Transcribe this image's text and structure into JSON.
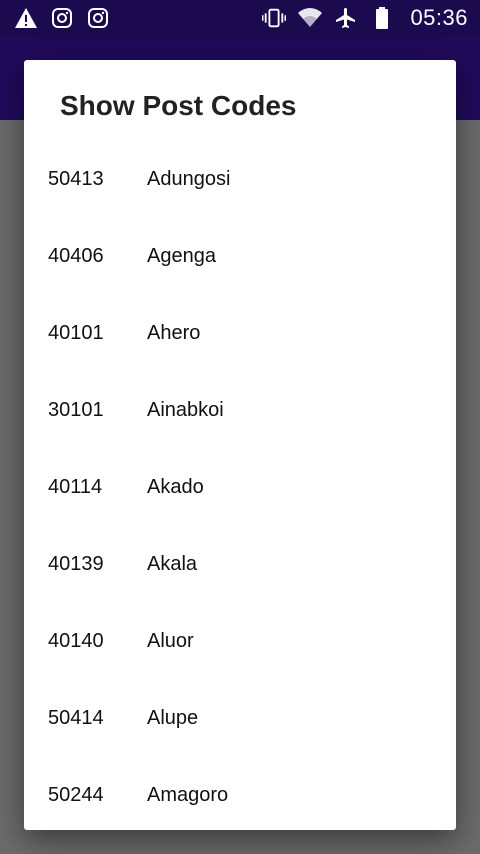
{
  "status_bar": {
    "left_icons": [
      "warning-icon",
      "instagram-icon",
      "instagram-icon"
    ],
    "right_icons": [
      "vibrate-icon",
      "wifi-icon",
      "airplane-icon",
      "battery-icon"
    ],
    "time": "05:36",
    "background": "#1c0a4e"
  },
  "app_bar": {
    "background": "#2a0e78"
  },
  "dialog": {
    "title": "Show Post Codes",
    "items": [
      {
        "code": "50413",
        "name": "Adungosi"
      },
      {
        "code": "40406",
        "name": "Agenga"
      },
      {
        "code": "40101",
        "name": "Ahero"
      },
      {
        "code": "30101",
        "name": "Ainabkoi"
      },
      {
        "code": "40114",
        "name": "Akado"
      },
      {
        "code": "40139",
        "name": "Akala"
      },
      {
        "code": "40140",
        "name": "Aluor"
      },
      {
        "code": "50414",
        "name": "Alupe"
      },
      {
        "code": "50244",
        "name": "Amagoro"
      }
    ]
  }
}
